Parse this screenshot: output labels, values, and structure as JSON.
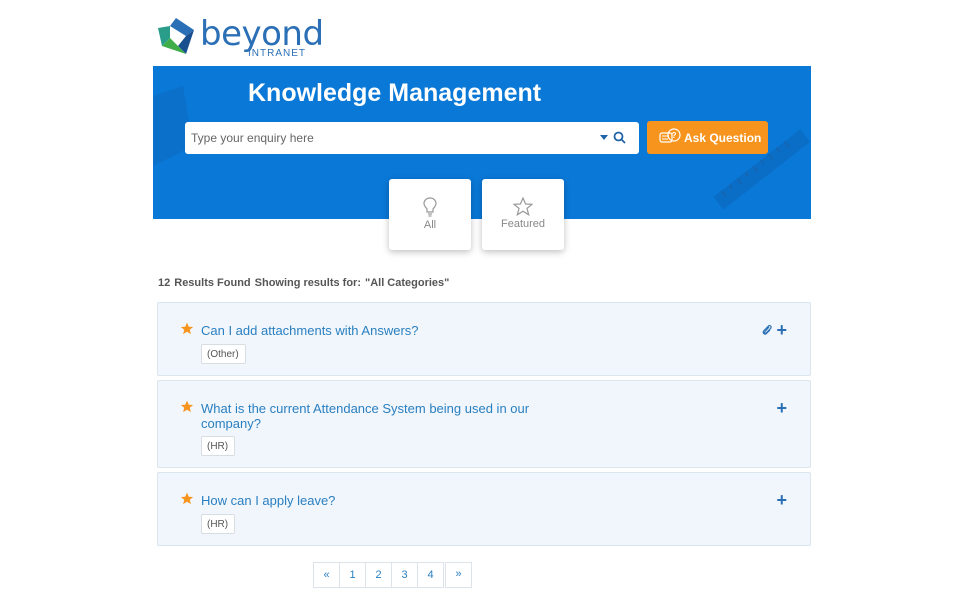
{
  "logo": {
    "word": "beyond",
    "sub": "INTRANET",
    "icon": "beyond-logo-mark"
  },
  "banner": {
    "title": "Knowledge Management",
    "search": {
      "placeholder": "Type your enquiry here",
      "value": ""
    },
    "ask_label": "Ask Question",
    "colors": {
      "banner": "#0a78d7",
      "ask": "#f7941d"
    }
  },
  "categories": [
    {
      "label": "All",
      "icon": "lightbulb-icon"
    },
    {
      "label": "Featured",
      "icon": "star-outline-icon"
    }
  ],
  "results": {
    "count": "12",
    "found": "Results Found",
    "showing": "Showing results for:",
    "filter": "\"All Categories\""
  },
  "questions": [
    {
      "title": "Can I add attachments with Answers?",
      "tag": "(Other)",
      "has_attachment": true
    },
    {
      "title": "What is the current Attendance System being used in our company?",
      "tag": "(HR)",
      "has_attachment": false
    },
    {
      "title": "How can I apply leave?",
      "tag": "(HR)",
      "has_attachment": false
    }
  ],
  "pagination": {
    "prev": "«",
    "pages": [
      "1",
      "2",
      "3",
      "4"
    ],
    "next": "»"
  }
}
